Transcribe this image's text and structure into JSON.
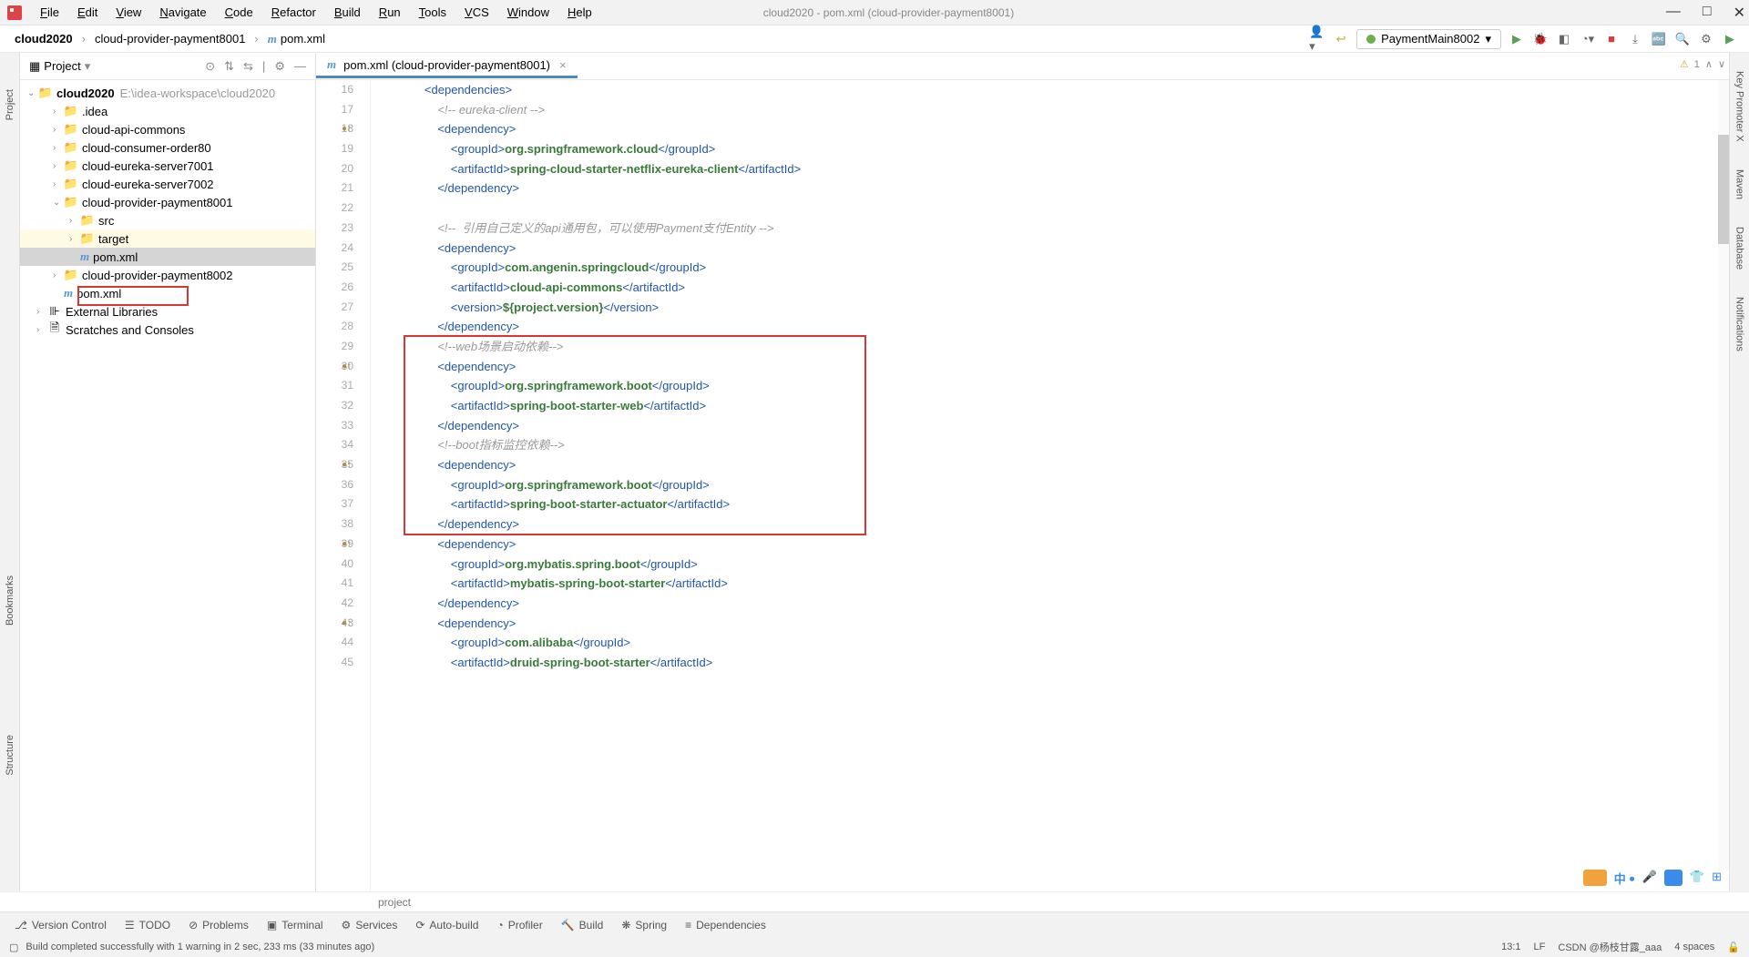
{
  "window": {
    "title": "cloud2020 - pom.xml (cloud-provider-payment8001)"
  },
  "menu": [
    "File",
    "Edit",
    "View",
    "Navigate",
    "Code",
    "Refactor",
    "Build",
    "Run",
    "Tools",
    "VCS",
    "Window",
    "Help"
  ],
  "breadcrumb": {
    "items": [
      "cloud2020",
      "cloud-provider-payment8001",
      "pom.xml"
    ]
  },
  "runConfig": "PaymentMain8002",
  "projectPanel": {
    "title": "Project",
    "root": {
      "name": "cloud2020",
      "path": "E:\\idea-workspace\\cloud2020"
    },
    "children": [
      {
        "name": ".idea",
        "type": "folder",
        "depth": 1
      },
      {
        "name": "cloud-api-commons",
        "type": "module",
        "depth": 1
      },
      {
        "name": "cloud-consumer-order80",
        "type": "module",
        "depth": 1
      },
      {
        "name": "cloud-eureka-server7001",
        "type": "module",
        "depth": 1
      },
      {
        "name": "cloud-eureka-server7002",
        "type": "module",
        "depth": 1
      },
      {
        "name": "cloud-provider-payment8001",
        "type": "module",
        "depth": 1,
        "expanded": true
      },
      {
        "name": "src",
        "type": "src",
        "depth": 2
      },
      {
        "name": "target",
        "type": "target",
        "depth": 2,
        "highlighted": true
      },
      {
        "name": "pom.xml",
        "type": "pom",
        "depth": 2,
        "selected": true,
        "boxed": true
      },
      {
        "name": "cloud-provider-payment8002",
        "type": "module",
        "depth": 1
      },
      {
        "name": "pom.xml",
        "type": "pom",
        "depth": 1
      },
      {
        "name": "External Libraries",
        "type": "lib",
        "depth": 0
      },
      {
        "name": "Scratches and Consoles",
        "type": "scratch",
        "depth": 0
      }
    ]
  },
  "editorTab": "pom.xml (cloud-provider-payment8001)",
  "code": {
    "startLine": 16,
    "lines": [
      {
        "n": 16,
        "indent": 2,
        "parts": [
          {
            "t": "tag",
            "v": "<dependencies>"
          }
        ]
      },
      {
        "n": 17,
        "indent": 3,
        "parts": [
          {
            "t": "comment",
            "v": "<!-- eureka-client -->"
          }
        ]
      },
      {
        "n": 18,
        "indent": 3,
        "mark": true,
        "parts": [
          {
            "t": "tag",
            "v": "<dependency>"
          }
        ]
      },
      {
        "n": 19,
        "indent": 4,
        "parts": [
          {
            "t": "tag",
            "v": "<groupId>"
          },
          {
            "t": "text",
            "v": "org.springframework.cloud"
          },
          {
            "t": "tag",
            "v": "</groupId>"
          }
        ]
      },
      {
        "n": 20,
        "indent": 4,
        "parts": [
          {
            "t": "tag",
            "v": "<artifactId>"
          },
          {
            "t": "text",
            "v": "spring-cloud-starter-netflix-eureka-client"
          },
          {
            "t": "tag",
            "v": "</artifactId>"
          }
        ]
      },
      {
        "n": 21,
        "indent": 3,
        "parts": [
          {
            "t": "tag",
            "v": "</dependency>"
          }
        ]
      },
      {
        "n": 22,
        "indent": 0,
        "parts": []
      },
      {
        "n": 23,
        "indent": 3,
        "parts": [
          {
            "t": "comment",
            "v": "<!--  引用自己定义的api通用包，可以使用Payment支付Entity -->"
          }
        ]
      },
      {
        "n": 24,
        "indent": 3,
        "parts": [
          {
            "t": "tag",
            "v": "<dependency>"
          }
        ]
      },
      {
        "n": 25,
        "indent": 4,
        "parts": [
          {
            "t": "tag",
            "v": "<groupId>"
          },
          {
            "t": "text",
            "v": "com.angenin.springcloud"
          },
          {
            "t": "tag",
            "v": "</groupId>"
          }
        ]
      },
      {
        "n": 26,
        "indent": 4,
        "parts": [
          {
            "t": "tag",
            "v": "<artifactId>"
          },
          {
            "t": "text",
            "v": "cloud-api-commons"
          },
          {
            "t": "tag",
            "v": "</artifactId>"
          }
        ]
      },
      {
        "n": 27,
        "indent": 4,
        "parts": [
          {
            "t": "tag",
            "v": "<version>"
          },
          {
            "t": "text",
            "v": "${project.version}"
          },
          {
            "t": "tag",
            "v": "</version>"
          }
        ]
      },
      {
        "n": 28,
        "indent": 3,
        "parts": [
          {
            "t": "tag",
            "v": "</dependency>"
          }
        ]
      },
      {
        "n": 29,
        "indent": 3,
        "parts": [
          {
            "t": "comment",
            "v": "<!--web场景启动依赖-->"
          }
        ]
      },
      {
        "n": 30,
        "indent": 3,
        "mark": true,
        "parts": [
          {
            "t": "tag",
            "v": "<dependency>"
          }
        ]
      },
      {
        "n": 31,
        "indent": 4,
        "parts": [
          {
            "t": "tag",
            "v": "<groupId>"
          },
          {
            "t": "text",
            "v": "org.springframework.boot"
          },
          {
            "t": "tag",
            "v": "</groupId>"
          }
        ]
      },
      {
        "n": 32,
        "indent": 4,
        "parts": [
          {
            "t": "tag",
            "v": "<artifactId>"
          },
          {
            "t": "text",
            "v": "spring-boot-starter-web"
          },
          {
            "t": "tag",
            "v": "</artifactId>"
          }
        ]
      },
      {
        "n": 33,
        "indent": 3,
        "parts": [
          {
            "t": "tag",
            "v": "</dependency>"
          }
        ]
      },
      {
        "n": 34,
        "indent": 3,
        "parts": [
          {
            "t": "comment",
            "v": "<!--boot指标监控依赖-->"
          }
        ]
      },
      {
        "n": 35,
        "indent": 3,
        "mark": true,
        "parts": [
          {
            "t": "tag",
            "v": "<dependency>"
          }
        ]
      },
      {
        "n": 36,
        "indent": 4,
        "parts": [
          {
            "t": "tag",
            "v": "<groupId>"
          },
          {
            "t": "text",
            "v": "org.springframework.boot"
          },
          {
            "t": "tag",
            "v": "</groupId>"
          }
        ]
      },
      {
        "n": 37,
        "indent": 4,
        "parts": [
          {
            "t": "tag",
            "v": "<artifactId>"
          },
          {
            "t": "text",
            "v": "spring-boot-starter-actuator"
          },
          {
            "t": "tag",
            "v": "</artifactId>"
          }
        ]
      },
      {
        "n": 38,
        "indent": 3,
        "parts": [
          {
            "t": "tag",
            "v": "</dependency>"
          }
        ]
      },
      {
        "n": 39,
        "indent": 3,
        "mark": true,
        "parts": [
          {
            "t": "tag",
            "v": "<dependency>"
          }
        ]
      },
      {
        "n": 40,
        "indent": 4,
        "parts": [
          {
            "t": "tag",
            "v": "<groupId>"
          },
          {
            "t": "text",
            "v": "org.mybatis.spring.boot"
          },
          {
            "t": "tag",
            "v": "</groupId>"
          }
        ]
      },
      {
        "n": 41,
        "indent": 4,
        "parts": [
          {
            "t": "tag",
            "v": "<artifactId>"
          },
          {
            "t": "text",
            "v": "mybatis-spring-boot-starter"
          },
          {
            "t": "tag",
            "v": "</artifactId>"
          }
        ]
      },
      {
        "n": 42,
        "indent": 3,
        "parts": [
          {
            "t": "tag",
            "v": "</dependency>"
          }
        ]
      },
      {
        "n": 43,
        "indent": 3,
        "mark": true,
        "parts": [
          {
            "t": "tag",
            "v": "<dependency>"
          }
        ]
      },
      {
        "n": 44,
        "indent": 4,
        "parts": [
          {
            "t": "tag",
            "v": "<groupId>"
          },
          {
            "t": "text",
            "v": "com.alibaba"
          },
          {
            "t": "tag",
            "v": "</groupId>"
          }
        ]
      },
      {
        "n": 45,
        "indent": 4,
        "parts": [
          {
            "t": "tag",
            "v": "<artifactId>"
          },
          {
            "t": "text",
            "v": "druid-spring-boot-starter"
          },
          {
            "t": "tag",
            "v": "</artifactId>"
          }
        ]
      }
    ]
  },
  "breadcrumbBottom": "project",
  "bottomToolbar": [
    "Version Control",
    "TODO",
    "Problems",
    "Terminal",
    "Services",
    "Auto-build",
    "Profiler",
    "Build",
    "Spring",
    "Dependencies"
  ],
  "statusBar": {
    "left": "Build completed successfully with 1 warning in 2 sec, 233 ms (33 minutes ago)",
    "right": [
      "13:1",
      "LF",
      "CSDN @杨枝甘露_aaa",
      "4 spaces"
    ]
  },
  "indicators": {
    "warnings": "1"
  },
  "rightTools": [
    "Key Promoter X",
    "Maven",
    "Database",
    "Notifications"
  ]
}
